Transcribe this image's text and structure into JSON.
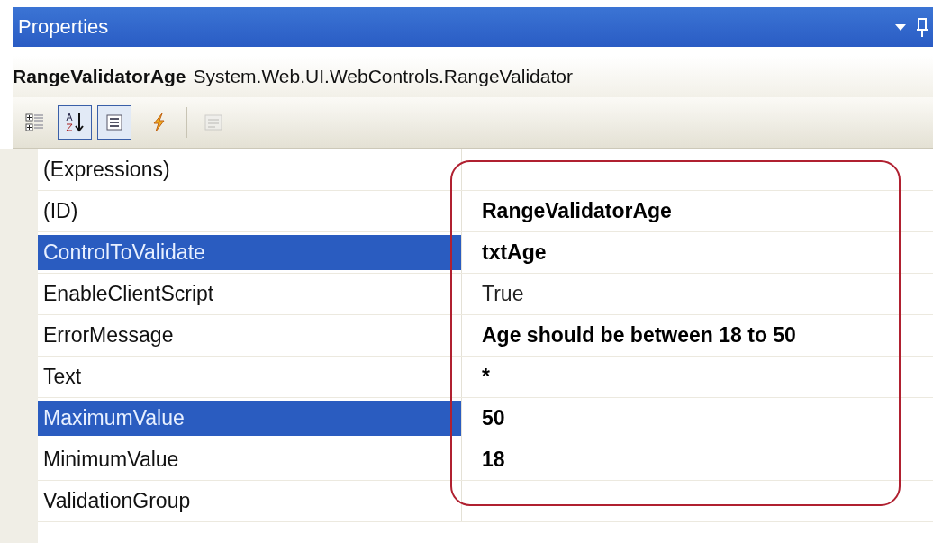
{
  "window": {
    "title": "Properties"
  },
  "object": {
    "name": "RangeValidatorAge",
    "type": "System.Web.UI.WebControls.RangeValidator"
  },
  "toolbar": [
    {
      "kind": "categorized",
      "pressed": false,
      "disabled": false
    },
    {
      "kind": "alphabetical",
      "pressed": true,
      "disabled": false
    },
    {
      "kind": "properties",
      "pressed": true,
      "disabled": false
    },
    {
      "kind": "events",
      "pressed": false,
      "disabled": false
    },
    {
      "kind": "property-pages",
      "pressed": false,
      "disabled": true
    }
  ],
  "properties": [
    {
      "name": "(Expressions)",
      "selected": false
    },
    {
      "name": "(ID)",
      "value": "RangeValidatorAge",
      "selected": false,
      "modified": true
    },
    {
      "name": "ControlToValidate",
      "value": "txtAge",
      "selected": true,
      "modified": true
    },
    {
      "name": "EnableClientScript",
      "value": "True",
      "selected": false,
      "modified": false
    },
    {
      "name": "ErrorMessage",
      "value": "Age should be between 18 to 50",
      "selected": false,
      "modified": true
    },
    {
      "name": "Text",
      "value": "*",
      "selected": false,
      "modified": true
    },
    {
      "name": "MaximumValue",
      "value": "50",
      "selected": true,
      "modified": true
    },
    {
      "name": "MinimumValue",
      "value": "18",
      "selected": false,
      "modified": true
    },
    {
      "name": "ValidationGroup",
      "selected": false
    }
  ]
}
